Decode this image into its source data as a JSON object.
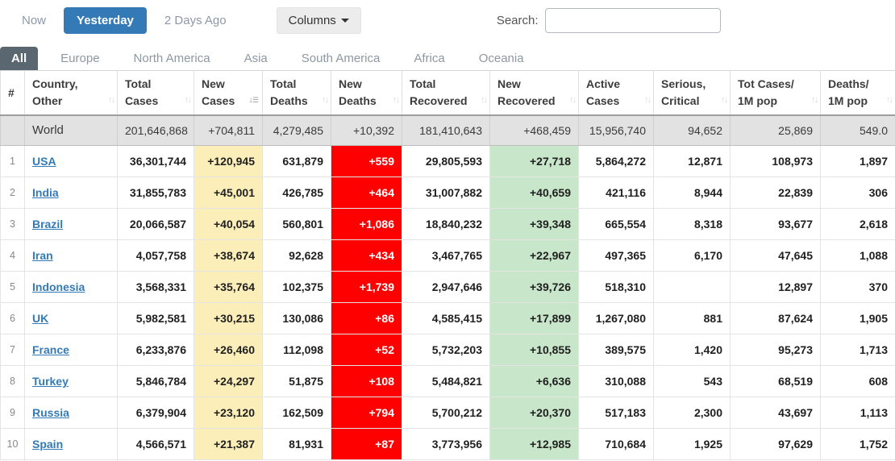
{
  "topbar": {
    "now_label": "Now",
    "yesterday_label": "Yesterday",
    "two_days_ago_label": "2 Days Ago",
    "columns_label": "Columns",
    "search_label": "Search:",
    "search_value": ""
  },
  "tabs": [
    {
      "label": "All",
      "selected": true
    },
    {
      "label": "Europe",
      "selected": false
    },
    {
      "label": "North America",
      "selected": false
    },
    {
      "label": "Asia",
      "selected": false
    },
    {
      "label": "South America",
      "selected": false
    },
    {
      "label": "Africa",
      "selected": false
    },
    {
      "label": "Oceania",
      "selected": false
    }
  ],
  "colors": {
    "primary_blue": "#337ab7",
    "selected_tab_bg": "#5b6770",
    "new_cases_bg": "#fbeeb8",
    "new_deaths_bg": "#ff0000",
    "new_recovered_bg": "#c8e6c9",
    "world_row_bg": "#e2e2e2"
  },
  "table": {
    "headers": [
      {
        "line1": "#",
        "line2": "",
        "sortable": false,
        "sorted": ""
      },
      {
        "line1": "Country,",
        "line2": "Other",
        "sortable": true,
        "sorted": ""
      },
      {
        "line1": "Total",
        "line2": "Cases",
        "sortable": true,
        "sorted": ""
      },
      {
        "line1": "New",
        "line2": "Cases",
        "sortable": true,
        "sorted": "desc"
      },
      {
        "line1": "Total",
        "line2": "Deaths",
        "sortable": true,
        "sorted": ""
      },
      {
        "line1": "New",
        "line2": "Deaths",
        "sortable": true,
        "sorted": ""
      },
      {
        "line1": "Total",
        "line2": "Recovered",
        "sortable": true,
        "sorted": ""
      },
      {
        "line1": "New",
        "line2": "Recovered",
        "sortable": true,
        "sorted": ""
      },
      {
        "line1": "Active",
        "line2": "Cases",
        "sortable": true,
        "sorted": ""
      },
      {
        "line1": "Serious,",
        "line2": "Critical",
        "sortable": true,
        "sorted": ""
      },
      {
        "line1": "Tot Cases/",
        "line2": "1M pop",
        "sortable": true,
        "sorted": ""
      },
      {
        "line1": "Deaths/",
        "line2": "1M pop",
        "sortable": true,
        "sorted": ""
      }
    ],
    "world_row": {
      "rank": "",
      "country": "World",
      "total_cases": "201,646,868",
      "new_cases": "+704,811",
      "total_deaths": "4,279,485",
      "new_deaths": "+10,392",
      "total_recovered": "181,410,643",
      "new_recovered": "+468,459",
      "active_cases": "15,956,740",
      "serious_critical": "94,652",
      "cases_per_1m": "25,869",
      "deaths_per_1m": "549.0"
    },
    "rows": [
      {
        "rank": "1",
        "country": "USA",
        "total_cases": "36,301,744",
        "new_cases": "+120,945",
        "total_deaths": "631,879",
        "new_deaths": "+559",
        "total_recovered": "29,805,593",
        "new_recovered": "+27,718",
        "active_cases": "5,864,272",
        "serious_critical": "12,871",
        "cases_per_1m": "108,973",
        "deaths_per_1m": "1,897"
      },
      {
        "rank": "2",
        "country": "India",
        "total_cases": "31,855,783",
        "new_cases": "+45,001",
        "total_deaths": "426,785",
        "new_deaths": "+464",
        "total_recovered": "31,007,882",
        "new_recovered": "+40,659",
        "active_cases": "421,116",
        "serious_critical": "8,944",
        "cases_per_1m": "22,839",
        "deaths_per_1m": "306"
      },
      {
        "rank": "3",
        "country": "Brazil",
        "total_cases": "20,066,587",
        "new_cases": "+40,054",
        "total_deaths": "560,801",
        "new_deaths": "+1,086",
        "total_recovered": "18,840,232",
        "new_recovered": "+39,348",
        "active_cases": "665,554",
        "serious_critical": "8,318",
        "cases_per_1m": "93,677",
        "deaths_per_1m": "2,618"
      },
      {
        "rank": "4",
        "country": "Iran",
        "total_cases": "4,057,758",
        "new_cases": "+38,674",
        "total_deaths": "92,628",
        "new_deaths": "+434",
        "total_recovered": "3,467,765",
        "new_recovered": "+22,967",
        "active_cases": "497,365",
        "serious_critical": "6,170",
        "cases_per_1m": "47,645",
        "deaths_per_1m": "1,088"
      },
      {
        "rank": "5",
        "country": "Indonesia",
        "total_cases": "3,568,331",
        "new_cases": "+35,764",
        "total_deaths": "102,375",
        "new_deaths": "+1,739",
        "total_recovered": "2,947,646",
        "new_recovered": "+39,726",
        "active_cases": "518,310",
        "serious_critical": "",
        "cases_per_1m": "12,897",
        "deaths_per_1m": "370"
      },
      {
        "rank": "6",
        "country": "UK",
        "total_cases": "5,982,581",
        "new_cases": "+30,215",
        "total_deaths": "130,086",
        "new_deaths": "+86",
        "total_recovered": "4,585,415",
        "new_recovered": "+17,899",
        "active_cases": "1,267,080",
        "serious_critical": "881",
        "cases_per_1m": "87,624",
        "deaths_per_1m": "1,905"
      },
      {
        "rank": "7",
        "country": "France",
        "total_cases": "6,233,876",
        "new_cases": "+26,460",
        "total_deaths": "112,098",
        "new_deaths": "+52",
        "total_recovered": "5,732,203",
        "new_recovered": "+10,855",
        "active_cases": "389,575",
        "serious_critical": "1,420",
        "cases_per_1m": "95,273",
        "deaths_per_1m": "1,713"
      },
      {
        "rank": "8",
        "country": "Turkey",
        "total_cases": "5,846,784",
        "new_cases": "+24,297",
        "total_deaths": "51,875",
        "new_deaths": "+108",
        "total_recovered": "5,484,821",
        "new_recovered": "+6,636",
        "active_cases": "310,088",
        "serious_critical": "543",
        "cases_per_1m": "68,519",
        "deaths_per_1m": "608"
      },
      {
        "rank": "9",
        "country": "Russia",
        "total_cases": "6,379,904",
        "new_cases": "+23,120",
        "total_deaths": "162,509",
        "new_deaths": "+794",
        "total_recovered": "5,700,212",
        "new_recovered": "+20,370",
        "active_cases": "517,183",
        "serious_critical": "2,300",
        "cases_per_1m": "43,697",
        "deaths_per_1m": "1,113"
      },
      {
        "rank": "10",
        "country": "Spain",
        "total_cases": "4,566,571",
        "new_cases": "+21,387",
        "total_deaths": "81,931",
        "new_deaths": "+87",
        "total_recovered": "3,773,956",
        "new_recovered": "+12,985",
        "active_cases": "710,684",
        "serious_critical": "1,925",
        "cases_per_1m": "97,629",
        "deaths_per_1m": "1,752"
      }
    ]
  }
}
